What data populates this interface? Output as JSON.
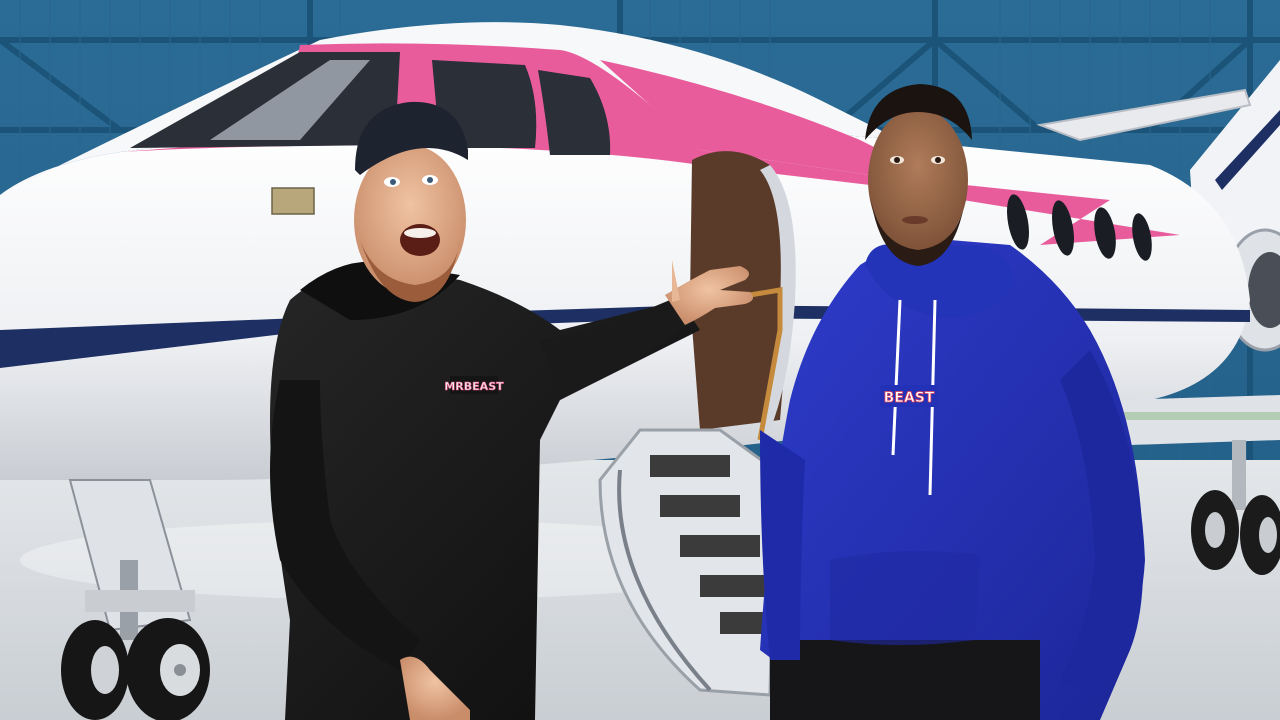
{
  "scene": {
    "description_alt": "",
    "colors": {
      "hangar_wall": "#2d6f99",
      "hangar_beam": "#1d5a80",
      "floor": "#d9dde0",
      "jet_body": "#f4f5f7",
      "jet_pink": "#e85c9c",
      "jet_navy_stripe": "#1d2f63",
      "black_hoodie": "#151515",
      "blue_hoodie": "#2331b7",
      "skin_light": "#e2b08f",
      "skin_dark": "#9a6a4c",
      "cap": "#1e2330",
      "door_interior": "#5a3b2a"
    },
    "logos": {
      "black_hoodie_logo": "MRBEAST",
      "blue_hoodie_logo": "BEAST"
    }
  }
}
